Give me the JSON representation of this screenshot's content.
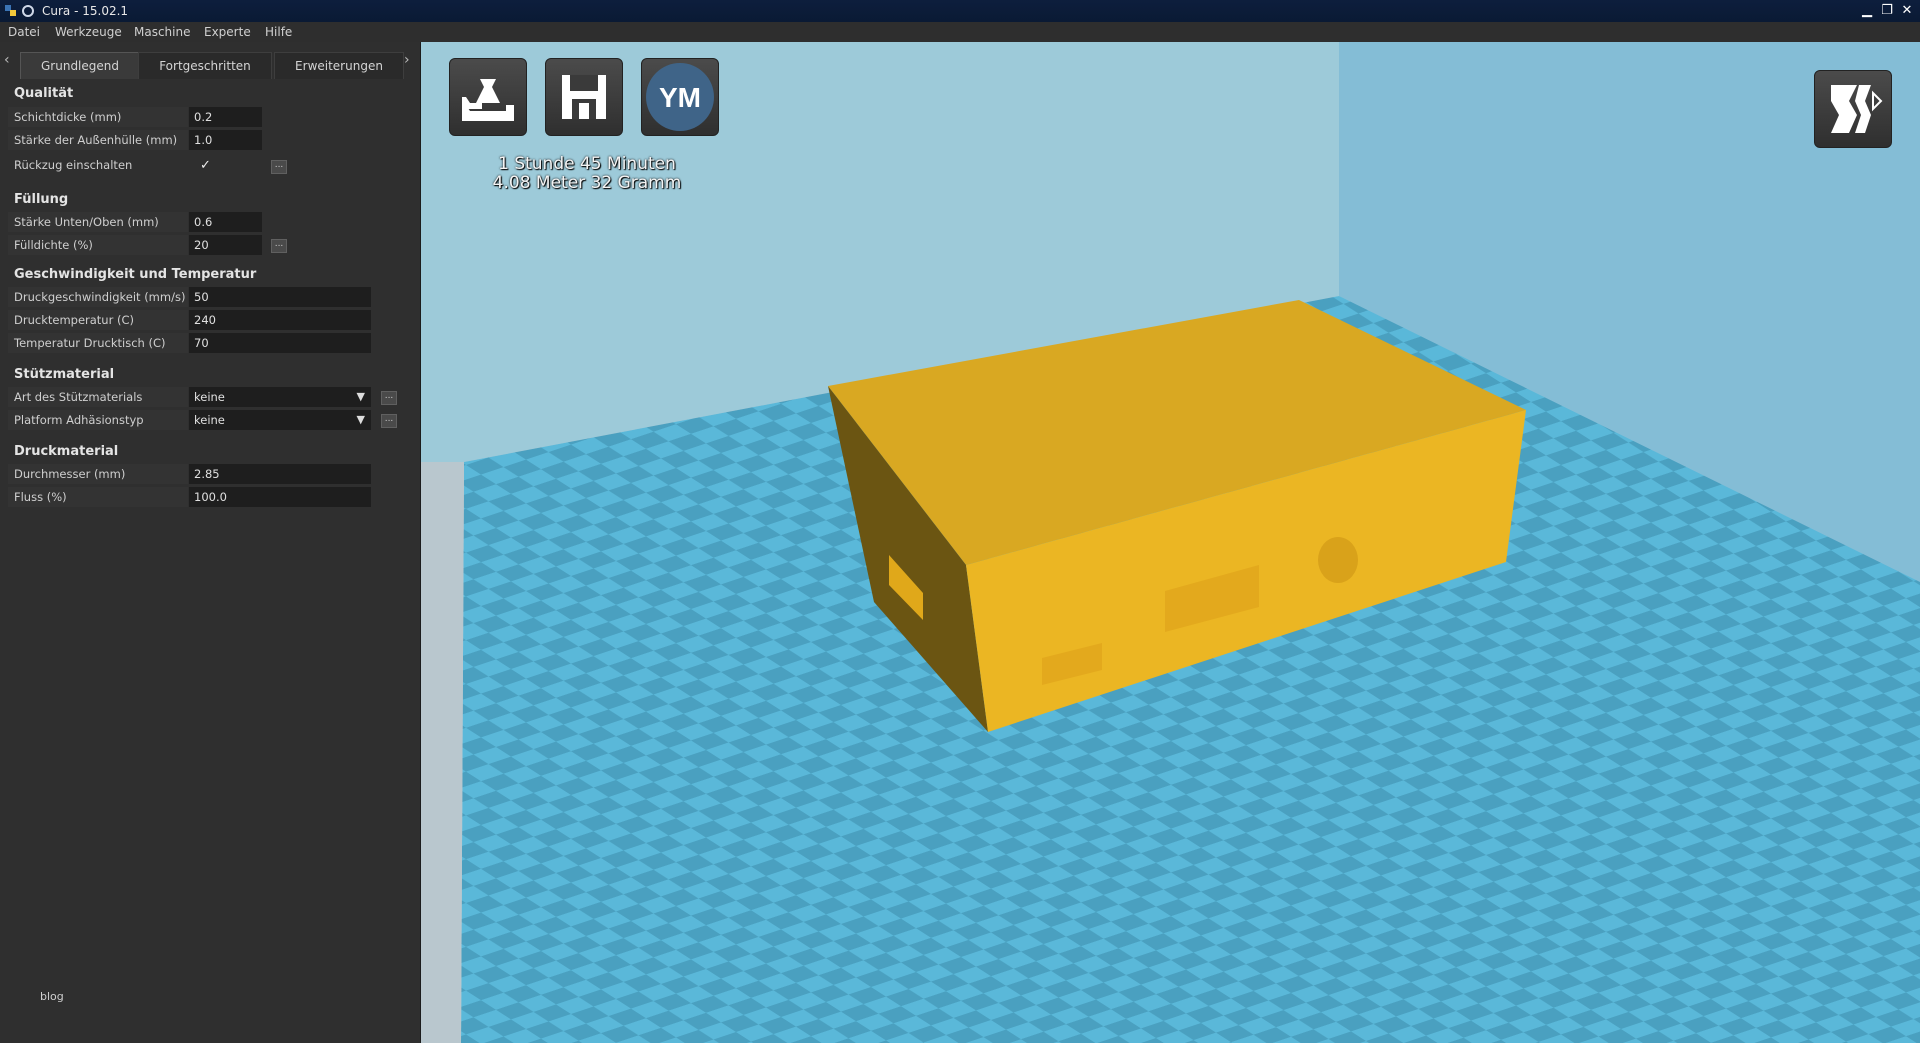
{
  "window": {
    "title": "Cura - 15.02.1",
    "minimize": "▁",
    "restore": "❐",
    "close": "✕"
  },
  "menu": [
    "Datei",
    "Werkzeuge",
    "Maschine",
    "Experte",
    "Hilfe"
  ],
  "tabs": {
    "left_arrow": "‹",
    "right_arrow": "›",
    "items": [
      "Grundlegend",
      "Fortgeschritten",
      "Erweiterungen"
    ]
  },
  "sections": {
    "quality": {
      "title": "Qualität",
      "layer_height": {
        "label": "Schichtdicke (mm)",
        "value": "0.2"
      },
      "shell_thickness": {
        "label": "Stärke der Außenhülle (mm)",
        "value": "1.0"
      },
      "retraction": {
        "label": "Rückzug einschalten",
        "checked": true,
        "check_glyph": "✓"
      }
    },
    "fill": {
      "title": "Füllung",
      "bottom_top": {
        "label": "Stärke Unten/Oben (mm)",
        "value": "0.6"
      },
      "density": {
        "label": "Fülldichte (%)",
        "value": "20"
      }
    },
    "speed": {
      "title": "Geschwindigkeit und Temperatur",
      "print_speed": {
        "label": "Druckgeschwindigkeit (mm/s)",
        "value": "50"
      },
      "print_temp": {
        "label": "Drucktemperatur (C)",
        "value": "240"
      },
      "bed_temp": {
        "label": "Temperatur Drucktisch (C)",
        "value": "70"
      }
    },
    "support": {
      "title": "Stützmaterial",
      "support_type": {
        "label": "Art des Stützmaterials",
        "value": "keine"
      },
      "adhesion": {
        "label": "Platform Adhäsionstyp",
        "value": "keine"
      }
    },
    "filament": {
      "title": "Druckmaterial",
      "diameter": {
        "label": "Durchmesser (mm)",
        "value": "2.85"
      },
      "flow": {
        "label": "Fluss (%)",
        "value": "100.0"
      }
    },
    "dots": "..."
  },
  "footer": {
    "text": "blog"
  },
  "viewport": {
    "print_time": "1 Stunde 45 Minuten",
    "print_material": "4.08 Meter 32 Gramm",
    "buttons": [
      "load-icon",
      "save-icon",
      "ym-icon",
      "view-mode-icon"
    ],
    "ym_label": "YM",
    "colors": {
      "model": "#ebb623",
      "wall": "#8fc3d6",
      "floor_light": "#5ab8d9",
      "floor_dark": "#4aa0c0",
      "floor_base": "#cfcfcf"
    }
  }
}
